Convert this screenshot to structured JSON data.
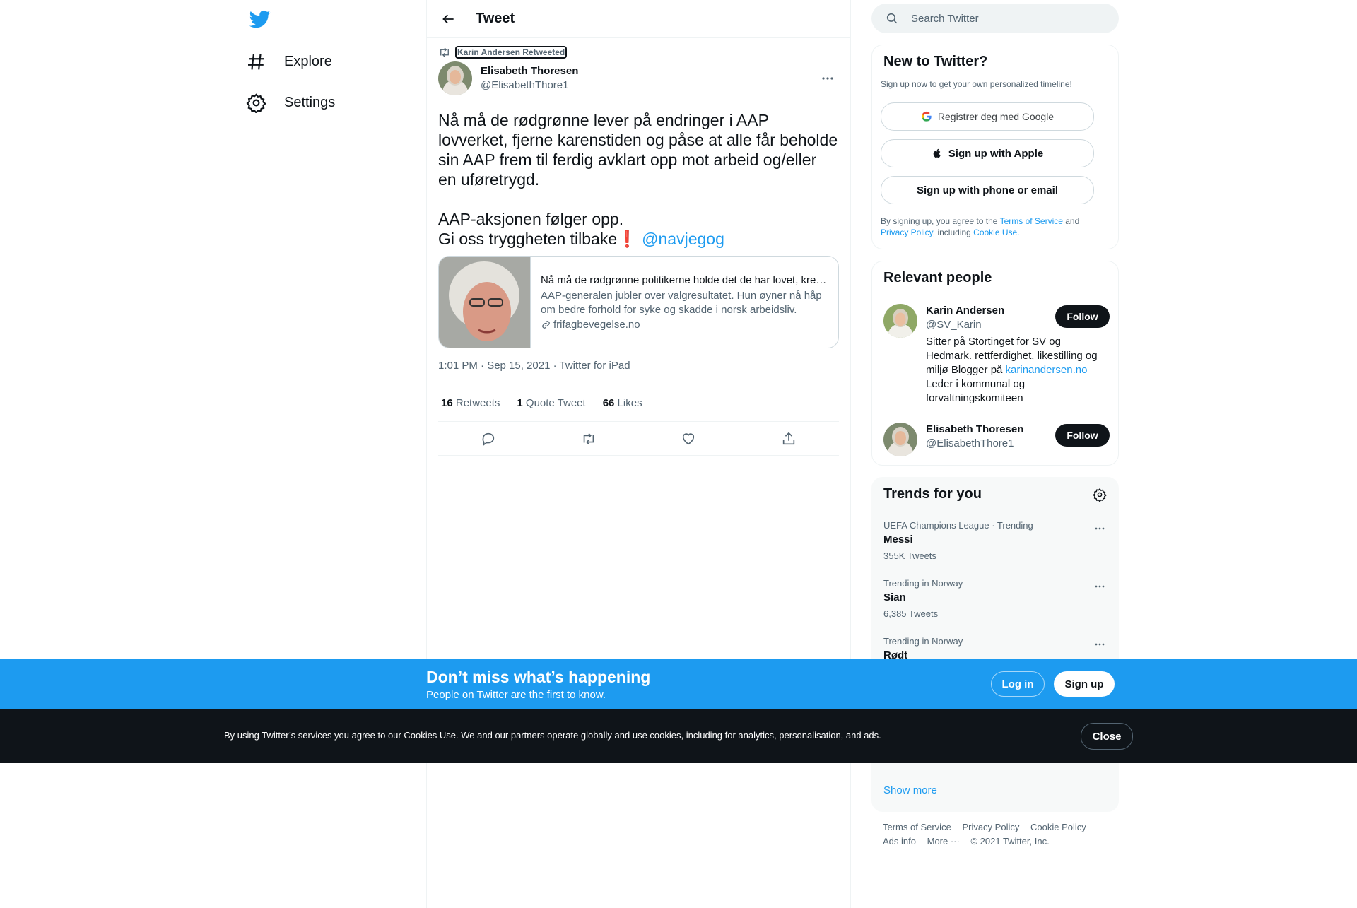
{
  "colors": {
    "accent": "#1d9bf0",
    "text": "#0f1419",
    "muted": "#536471",
    "banner": "#1d9bf0",
    "cookie_bar": "#0f1419"
  },
  "nav": {
    "logo_icon": "twitter-bird-icon",
    "items": [
      {
        "label": "Explore",
        "icon": "hashtag-icon"
      },
      {
        "label": "Settings",
        "icon": "gear-icon"
      }
    ]
  },
  "header": {
    "title": "Tweet",
    "back_icon": "arrow-left-icon"
  },
  "tweet": {
    "retweeted_by": "Karin Andersen Retweeted",
    "author_name": "Elisabeth Thoresen",
    "author_handle": "@ElisabethThore1",
    "text_main": "Nå må de rødgrønne lever på endringer i AAP lovverket, fjerne karenstiden og påse at alle får beholde sin AAP frem til ferdig avklart opp mot arbeid og/eller en uføretrygd.\n\nAAP-aksjonen følger opp.\nGi oss tryggheten tilbake",
    "emoji": "❗",
    "mention": "@navjegog",
    "card": {
      "title": "Nå må de rødgrønne politikerne holde det de har lovet, krever AAP-generalen",
      "description": "AAP-generalen jubler over valgresultatet. Hun øyner nå håp om bedre forhold for syke og skadde i norsk arbeidsliv.",
      "domain": "frifagbevegelse.no"
    },
    "meta": "1:01 PM · Sep 15, 2021 · Twitter for iPad",
    "stats": [
      {
        "count": "16",
        "label": "Retweets"
      },
      {
        "count": "1",
        "label": "Quote Tweet"
      },
      {
        "count": "66",
        "label": "Likes"
      }
    ]
  },
  "search": {
    "placeholder": "Search Twitter"
  },
  "signup": {
    "title": "New to Twitter?",
    "subtitle": "Sign up now to get your own personalized timeline!",
    "google": "Registrer deg med Google",
    "apple": "Sign up with Apple",
    "phone": "Sign up with phone or email",
    "legal_1": "By signing up, you agree to the ",
    "terms": "Terms of Service",
    "legal_2": " and ",
    "privacy": "Privacy Policy",
    "legal_3": ", including ",
    "cookie": "Cookie Use."
  },
  "relevant": {
    "title": "Relevant people",
    "people": [
      {
        "name": "Karin Andersen",
        "handle": "@SV_Karin",
        "bio_1": "Sitter på Stortinget for SV og Hedmark. rettferdighet, likestilling og miljø Blogger på ",
        "bio_link": "karinandersen.no",
        "bio_2": " Leder i kommunal og forvaltningskomiteen",
        "follow": "Follow"
      },
      {
        "name": "Elisabeth Thoresen",
        "handle": "@ElisabethThore1",
        "follow": "Follow"
      }
    ]
  },
  "trends": {
    "title": "Trends for you",
    "items": [
      {
        "context": "UEFA Champions League · Trending",
        "name": "Messi",
        "count": "355K Tweets"
      },
      {
        "context": "Trending in Norway",
        "name": "Sian",
        "count": "6,385 Tweets"
      },
      {
        "context": "Trending in Norway",
        "name": "Rødt",
        "count": ""
      }
    ],
    "show_more": "Show more"
  },
  "footer": {
    "links": [
      "Terms of Service",
      "Privacy Policy",
      "Cookie Policy",
      "Ads info",
      "More ···"
    ],
    "copyright": "© 2021 Twitter, Inc."
  },
  "promo": {
    "title": "Don’t miss what’s happening",
    "subtitle": "People on Twitter are the first to know.",
    "login": "Log in",
    "signup": "Sign up"
  },
  "cookie_bar": {
    "text": "By using Twitter’s services you agree to our Cookies Use. We and our partners operate globally and use cookies, including for analytics, personalisation, and ads.",
    "close": "Close"
  }
}
